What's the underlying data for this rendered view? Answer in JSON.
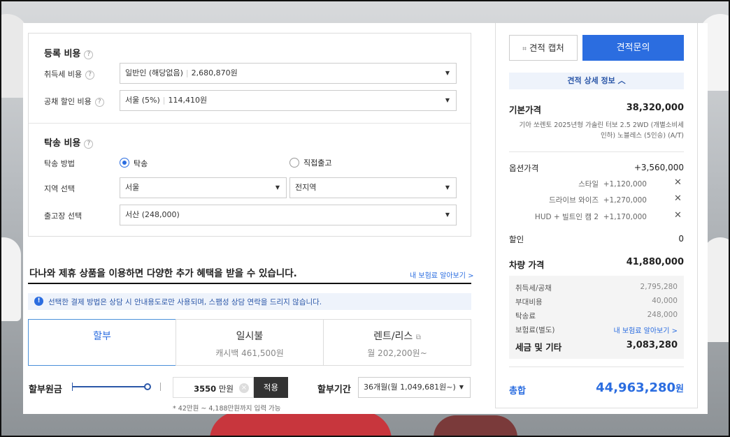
{
  "colors": {
    "accent": "#2b6de0",
    "notice_bg": "#eef3fb",
    "dark_button": "#333333"
  },
  "registration": {
    "title": "등록 비용",
    "tax_label": "취득세 비용",
    "tax_type": "일반인 (해당없음)",
    "tax_amount": "2,680,870원",
    "bond_label": "공채 할인 비용",
    "bond_type": "서울 (5%)",
    "bond_amount": "114,410원"
  },
  "delivery": {
    "title": "탁송 비용",
    "method_label": "탁송 방법",
    "method_delivery": "탁송",
    "method_direct": "직접출고",
    "region_label": "지역 선택",
    "region": "서울",
    "district": "전지역",
    "center_label": "출고장 선택",
    "center": "서산 (248,000)"
  },
  "partner": {
    "heading": "다나와 제휴 상품을 이용하면 다양한 추가 혜택을 받을 수 있습니다.",
    "insurance_link": "내 보험료 알아보기 >",
    "notice": "선택한 결제 방법은 상담 시 안내용도로만 사용되며, 스팸성 상담 연락을 드리지 않습니다."
  },
  "payment_tabs": [
    {
      "label": "할부",
      "sub": ""
    },
    {
      "label": "일시불",
      "sub": "캐시백 461,500원"
    },
    {
      "label": "렌트/리스",
      "sub": "월 202,200원~"
    }
  ],
  "installment": {
    "principal_label": "할부원금",
    "amount": "3550",
    "unit": "만원",
    "apply": "적용",
    "range_hint": "* 42만원 ~ 4,188만원까지 입력 가능",
    "period_label": "할부기간",
    "period": "36개월(월 1,049,681원~)",
    "slider_fraction": 0.85
  },
  "quote": {
    "capture_button": "견적 캡처",
    "inquiry_button": "견적문의",
    "detail_toggle": "견적 상세 정보",
    "base_label": "기본가격",
    "base_price": "38,320,000",
    "model_desc": "기아 쏘렌토 2025년형 가솔린 터보 2.5 2WD (개별소비세 인하) 노블레스 (5인승) (A/T)",
    "options_label": "옵션가격",
    "options_total": "+3,560,000",
    "options": [
      {
        "name": "스타일",
        "price": "+1,120,000"
      },
      {
        "name": "드라이브 와이즈",
        "price": "+1,270,000"
      },
      {
        "name": "HUD + 빌트인 캠 2",
        "price": "+1,170,000"
      }
    ],
    "discount_label": "할인",
    "discount": "0",
    "vehicle_label": "차량 가격",
    "vehicle_price": "41,880,000",
    "fees": [
      {
        "label": "취득세/공채",
        "value": "2,795,280"
      },
      {
        "label": "부대비용",
        "value": "40,000"
      },
      {
        "label": "탁송료",
        "value": "248,000"
      },
      {
        "label": "보험료(별도)",
        "value": "내 보험료 알아보기 >"
      }
    ],
    "tax_etc_label": "세금 및 기타",
    "tax_etc": "3,083,280",
    "total_label": "총합",
    "total": "44,963,280",
    "total_unit": "원"
  }
}
